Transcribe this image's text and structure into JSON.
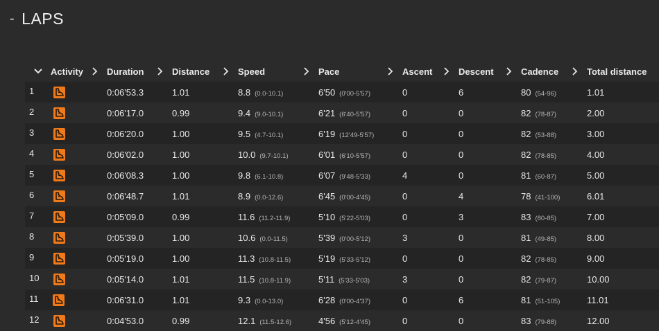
{
  "section": {
    "collapse_symbol": "-",
    "title": "LAPS"
  },
  "columns": [
    "Activity",
    "Duration",
    "Distance",
    "Speed",
    "Pace",
    "Ascent",
    "Descent",
    "Cadence",
    "Total distance"
  ],
  "laps": [
    {
      "num": "1",
      "duration": "0:06'53.3",
      "distance": "1.01",
      "speed": "8.8",
      "speed_range": "(0.0-10.1)",
      "pace": "6'50",
      "pace_range": "(0'00-5'57)",
      "ascent": "0",
      "descent": "6",
      "cadence": "80",
      "cadence_range": "(54-96)",
      "total": "1.01"
    },
    {
      "num": "2",
      "duration": "0:06'17.0",
      "distance": "0.99",
      "speed": "9.4",
      "speed_range": "(9.0-10.1)",
      "pace": "6'21",
      "pace_range": "(6'40-5'57)",
      "ascent": "0",
      "descent": "0",
      "cadence": "82",
      "cadence_range": "(78-87)",
      "total": "2.00"
    },
    {
      "num": "3",
      "duration": "0:06'20.0",
      "distance": "1.00",
      "speed": "9.5",
      "speed_range": "(4.7-10.1)",
      "pace": "6'19",
      "pace_range": "(12'49-5'57)",
      "ascent": "0",
      "descent": "0",
      "cadence": "82",
      "cadence_range": "(53-88)",
      "total": "3.00"
    },
    {
      "num": "4",
      "duration": "0:06'02.0",
      "distance": "1.00",
      "speed": "10.0",
      "speed_range": "(9.7-10.1)",
      "pace": "6'01",
      "pace_range": "(6'10-5'57)",
      "ascent": "0",
      "descent": "0",
      "cadence": "82",
      "cadence_range": "(78-85)",
      "total": "4.00"
    },
    {
      "num": "5",
      "duration": "0:06'08.3",
      "distance": "1.00",
      "speed": "9.8",
      "speed_range": "(6.1-10.8)",
      "pace": "6'07",
      "pace_range": "(9'48-5'33)",
      "ascent": "4",
      "descent": "0",
      "cadence": "81",
      "cadence_range": "(60-87)",
      "total": "5.00"
    },
    {
      "num": "6",
      "duration": "0:06'48.7",
      "distance": "1.01",
      "speed": "8.9",
      "speed_range": "(0.0-12.6)",
      "pace": "6'45",
      "pace_range": "(0'00-4'45)",
      "ascent": "0",
      "descent": "4",
      "cadence": "78",
      "cadence_range": "(41-100)",
      "total": "6.01"
    },
    {
      "num": "7",
      "duration": "0:05'09.0",
      "distance": "0.99",
      "speed": "11.6",
      "speed_range": "(11.2-11.9)",
      "pace": "5'10",
      "pace_range": "(5'22-5'03)",
      "ascent": "0",
      "descent": "3",
      "cadence": "83",
      "cadence_range": "(80-85)",
      "total": "7.00"
    },
    {
      "num": "8",
      "duration": "0:05'39.0",
      "distance": "1.00",
      "speed": "10.6",
      "speed_range": "(0.0-11.5)",
      "pace": "5'39",
      "pace_range": "(0'00-5'12)",
      "ascent": "3",
      "descent": "0",
      "cadence": "81",
      "cadence_range": "(49-85)",
      "total": "8.00"
    },
    {
      "num": "9",
      "duration": "0:05'19.0",
      "distance": "1.00",
      "speed": "11.3",
      "speed_range": "(10.8-11.5)",
      "pace": "5'19",
      "pace_range": "(5'33-5'12)",
      "ascent": "0",
      "descent": "0",
      "cadence": "82",
      "cadence_range": "(78-85)",
      "total": "9.00"
    },
    {
      "num": "10",
      "duration": "0:05'14.0",
      "distance": "1.01",
      "speed": "11.5",
      "speed_range": "(10.8-11.9)",
      "pace": "5'11",
      "pace_range": "(5'33-5'03)",
      "ascent": "3",
      "descent": "0",
      "cadence": "82",
      "cadence_range": "(79-87)",
      "total": "10.00"
    },
    {
      "num": "11",
      "duration": "0:06'31.0",
      "distance": "1.01",
      "speed": "9.3",
      "speed_range": "(0.0-13.0)",
      "pace": "6'28",
      "pace_range": "(0'00-4'37)",
      "ascent": "0",
      "descent": "6",
      "cadence": "81",
      "cadence_range": "(51-105)",
      "total": "11.01"
    },
    {
      "num": "12",
      "duration": "0:04'53.0",
      "distance": "0.99",
      "speed": "12.1",
      "speed_range": "(11.5-12.6)",
      "pace": "4'56",
      "pace_range": "(5'12-4'45)",
      "ascent": "0",
      "descent": "0",
      "cadence": "83",
      "cadence_range": "(79-88)",
      "total": "12.00"
    }
  ],
  "colors": {
    "background": "#2b2b2b",
    "row_alt": "#242424",
    "activity_icon": "#f07a1a"
  },
  "icons": {
    "activity": "running-shoe-icon",
    "collapse": "chevron-down-icon",
    "column_separator": "chevron-right-icon"
  }
}
